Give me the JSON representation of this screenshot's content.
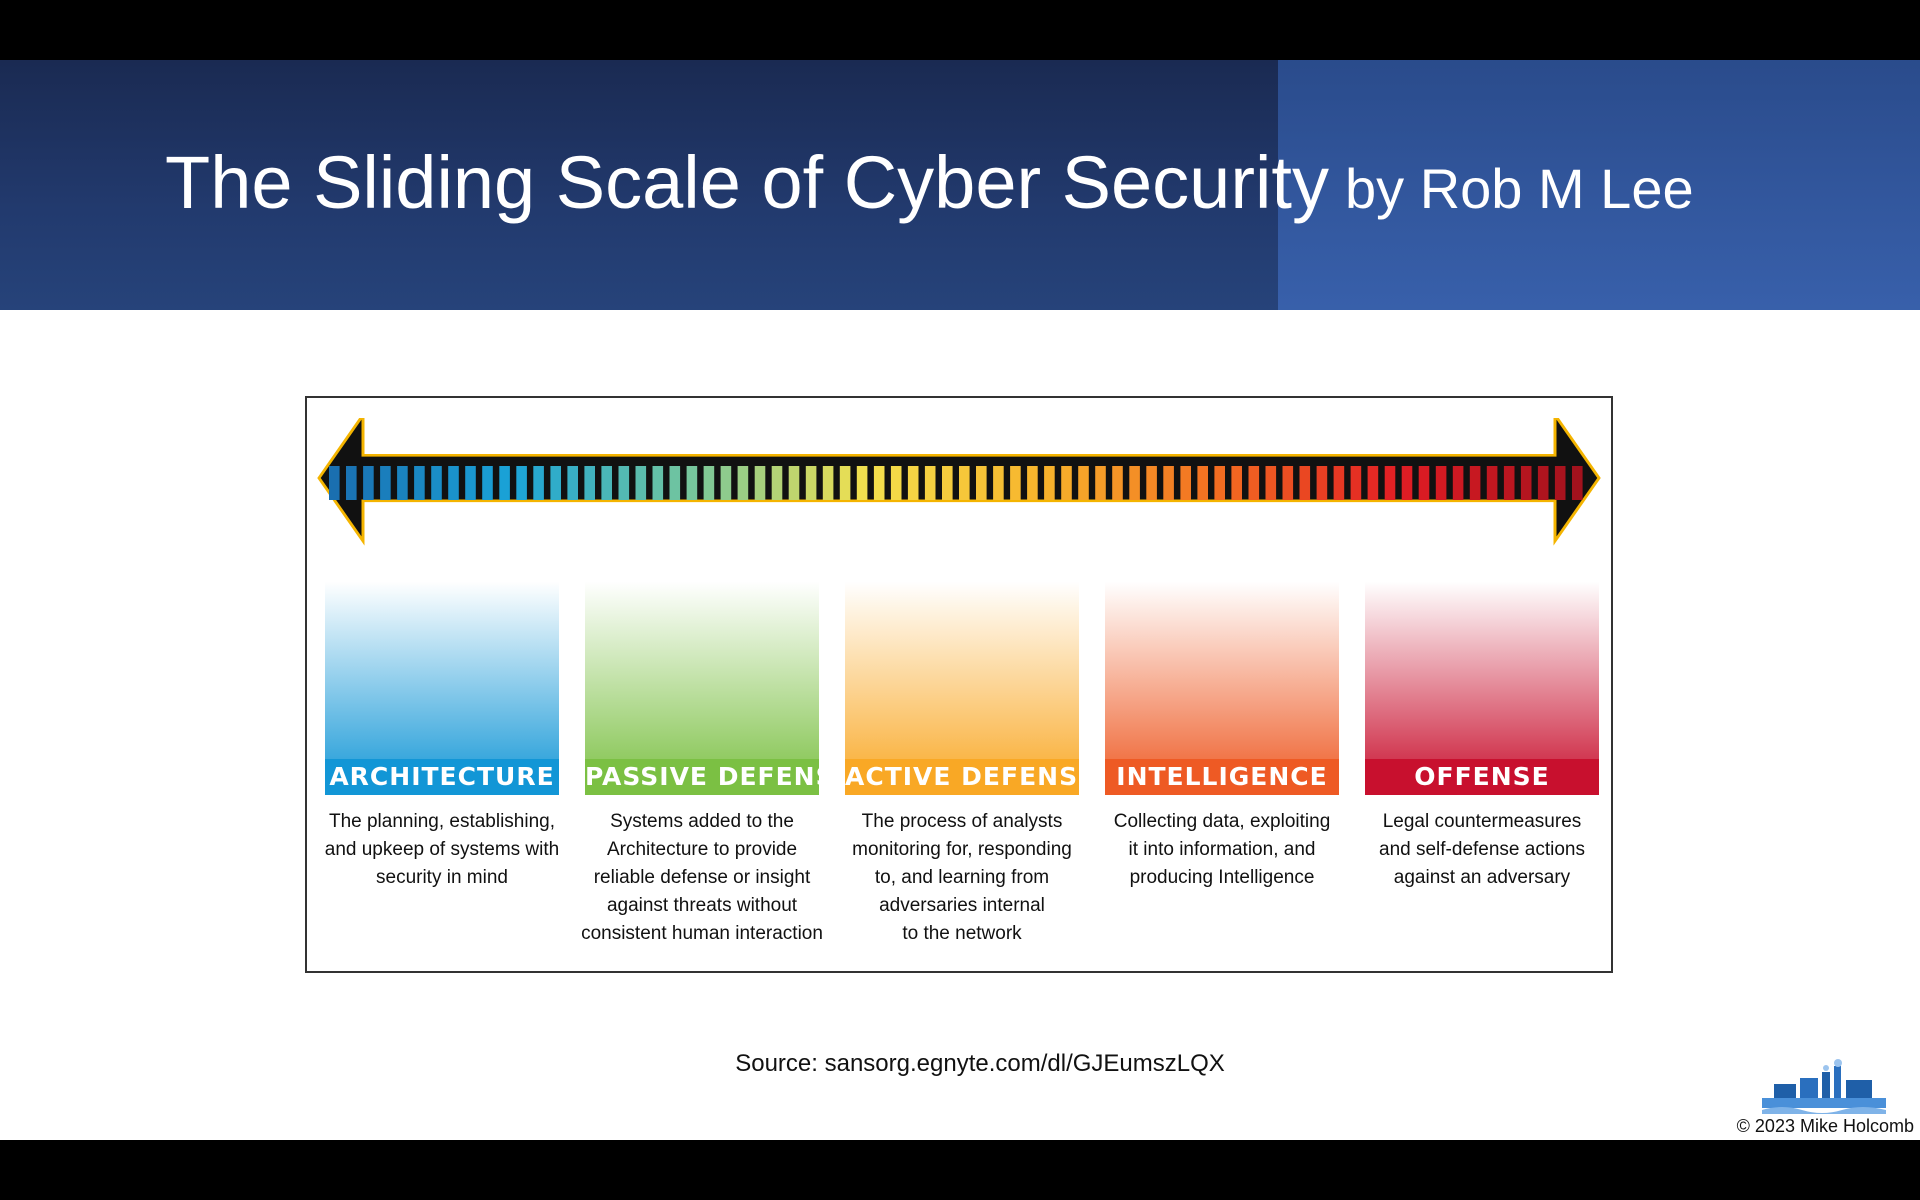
{
  "title": {
    "main": "The Sliding Scale of Cyber Security",
    "sub": "by Rob M Lee"
  },
  "categories": [
    {
      "label": "ARCHITECTURE",
      "desc": [
        "The planning, establishing,",
        "and upkeep of systems with",
        "security in mind"
      ],
      "color_top": "#ffffff",
      "color_bottom": "#1296d6"
    },
    {
      "label": "PASSIVE DEFENSE",
      "desc": [
        "Systems added to the",
        "Architecture to provide",
        "reliable defense or insight",
        "against threats without",
        "consistent human interaction"
      ],
      "color_top": "#ffffff",
      "color_bottom": "#7bc043"
    },
    {
      "label": "ACTIVE DEFENSE",
      "desc": [
        "The process of analysts",
        "monitoring for, responding",
        "to, and learning from",
        "adversaries internal",
        "to the network"
      ],
      "color_top": "#ffffff",
      "color_bottom": "#f9a825"
    },
    {
      "label": "INTELLIGENCE",
      "desc": [
        "Collecting data, exploiting",
        "it into information, and",
        "producing Intelligence"
      ],
      "color_top": "#ffffff",
      "color_bottom": "#ee5a24"
    },
    {
      "label": "OFFENSE",
      "desc": [
        "Legal countermeasures",
        "and self-defense actions",
        "against an adversary"
      ],
      "color_top": "#ffffff",
      "color_bottom": "#c8102e"
    }
  ],
  "scale_colors": [
    "#1a6fb0",
    "#1aa3d8",
    "#74c69d",
    "#f4e04d",
    "#f7b32b",
    "#f26b21",
    "#e11d24",
    "#a3121d"
  ],
  "source": "Source: sansorg.egnyte.com/dl/GJEumszLQX",
  "copyright": "© 2023 Mike Holcomb",
  "icons": {
    "logo": "industrial-plant-logo"
  }
}
